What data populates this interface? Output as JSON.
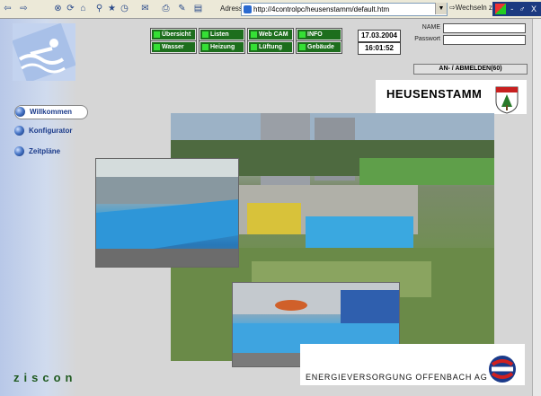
{
  "browser": {
    "address_label": "Adresse",
    "url": "http://4controlpc/heusenstamm/default.htm",
    "go_label": "Wechseln zu",
    "window_controls": "- ♂ X"
  },
  "nav_buttons": [
    {
      "label": "Übersicht"
    },
    {
      "label": "Listen"
    },
    {
      "label": "Web CAM"
    },
    {
      "label": "INFO"
    },
    {
      "label": "Wasser"
    },
    {
      "label": "Heizung"
    },
    {
      "label": "Lüftung"
    },
    {
      "label": "Gebäude"
    }
  ],
  "date": "17.03.2004",
  "time": "16:01:52",
  "login": {
    "name_label": "NAME",
    "password_label": "Passwort",
    "button_label": "AN- / ABMELDEN(60)"
  },
  "menu": [
    {
      "label": "Willkommen",
      "active": true
    },
    {
      "label": "Konfigurator",
      "active": false
    },
    {
      "label": "Zeitpläne",
      "active": false
    }
  ],
  "town_title": "HEUSENSTAMM",
  "brand_ziscon": "ziscon",
  "energy_label": "ENERGIEVERSORGUNG  OFFENBACH AG",
  "colors": {
    "nav_green": "#1d6e1d",
    "led": "#35e035",
    "menu_blue": "#1a3a8a",
    "eov_red": "#d02020",
    "eov_blue": "#1a3a8a"
  },
  "icons": [
    "back-icon",
    "forward-icon",
    "stop-icon",
    "refresh-icon",
    "home-icon",
    "search-icon",
    "favorites-icon",
    "history-icon",
    "mail-icon",
    "print-icon",
    "edit-icon"
  ]
}
